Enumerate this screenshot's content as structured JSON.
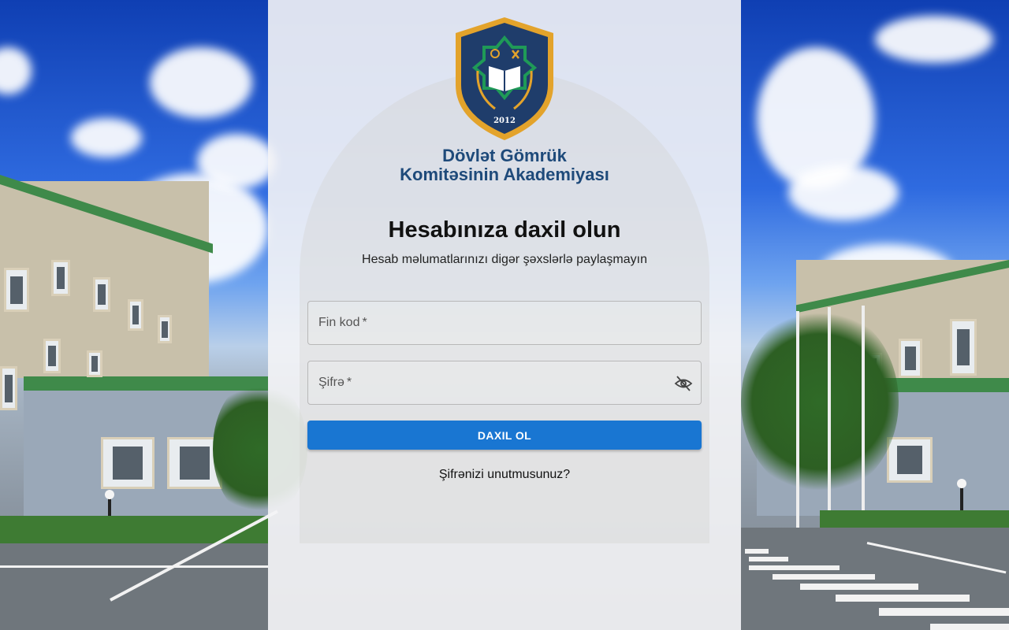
{
  "org": {
    "name_line1": "Dövlət Gömrük",
    "name_line2": "Komitəsinin Akademiyası",
    "logo_year": "2012"
  },
  "login": {
    "title": "Hesabınıza daxil olun",
    "subtitle": "Hesab məlumatlarınızı digər şəxslərlə paylaşmayın",
    "fin_label": "Fin kod",
    "password_label": "Şifrə",
    "required_marker": "*",
    "submit_label": "DAXIL OL",
    "forgot_label": "Şifrənizi unutmusunuz?"
  },
  "icons": {
    "password_toggle": "eye-off-icon",
    "logo": "academy-shield-emblem"
  },
  "colors": {
    "primary": "#1976d2",
    "brand_text": "#1e4a7a",
    "emblem_navy": "#1f3d6b",
    "emblem_gold": "#e3a32b",
    "emblem_green": "#1f9a57"
  }
}
